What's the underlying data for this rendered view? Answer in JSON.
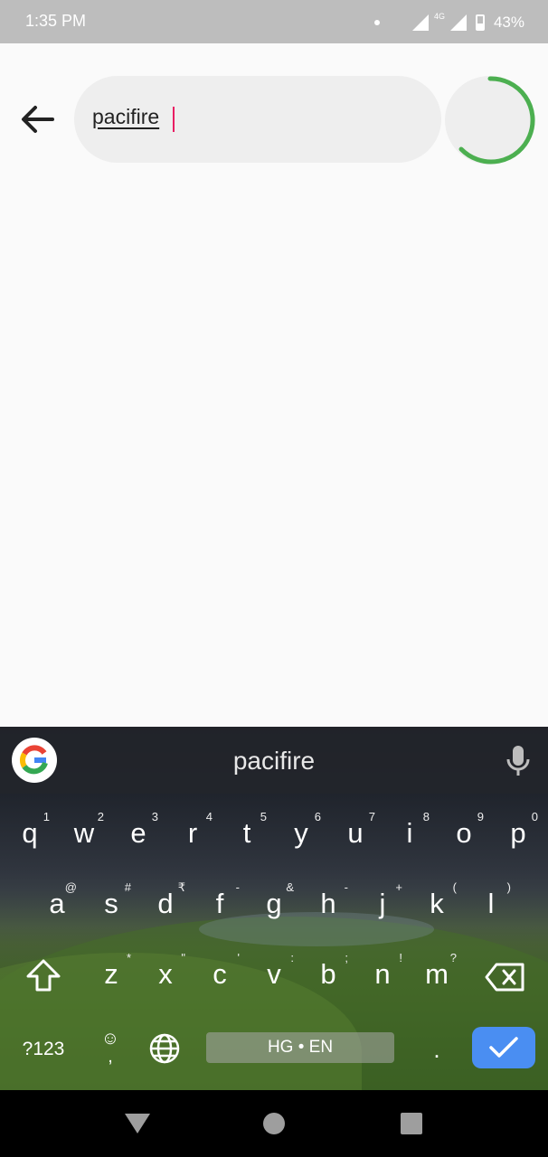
{
  "status_bar": {
    "time": "1:35 PM",
    "network": "4G",
    "battery": "43%"
  },
  "search": {
    "query": "pacifire"
  },
  "keyboard": {
    "suggestion": "pacifire",
    "row1": [
      {
        "key": "q",
        "hint": "1"
      },
      {
        "key": "w",
        "hint": "2"
      },
      {
        "key": "e",
        "hint": "3"
      },
      {
        "key": "r",
        "hint": "4"
      },
      {
        "key": "t",
        "hint": "5"
      },
      {
        "key": "y",
        "hint": "6"
      },
      {
        "key": "u",
        "hint": "7"
      },
      {
        "key": "i",
        "hint": "8"
      },
      {
        "key": "o",
        "hint": "9"
      },
      {
        "key": "p",
        "hint": "0"
      }
    ],
    "row2": [
      {
        "key": "a",
        "hint": "@"
      },
      {
        "key": "s",
        "hint": "#"
      },
      {
        "key": "d",
        "hint": "₹"
      },
      {
        "key": "f",
        "hint": "-"
      },
      {
        "key": "g",
        "hint": "&"
      },
      {
        "key": "h",
        "hint": "-"
      },
      {
        "key": "j",
        "hint": "+"
      },
      {
        "key": "k",
        "hint": "("
      },
      {
        "key": "l",
        "hint": ")"
      }
    ],
    "row3": [
      {
        "key": "z",
        "hint": "*"
      },
      {
        "key": "x",
        "hint": "\""
      },
      {
        "key": "c",
        "hint": "'"
      },
      {
        "key": "v",
        "hint": ":"
      },
      {
        "key": "b",
        "hint": ";"
      },
      {
        "key": "n",
        "hint": "!"
      },
      {
        "key": "m",
        "hint": "?"
      }
    ],
    "symbols_label": "?123",
    "emoji_label": "☺",
    "emoji_comma": ",",
    "space_label": "HG • EN",
    "period_label": ".",
    "colors": {
      "enter": "#4a8ef2"
    }
  },
  "colors": {
    "accent_caret": "#e91e63",
    "loader": "#4caf50"
  }
}
